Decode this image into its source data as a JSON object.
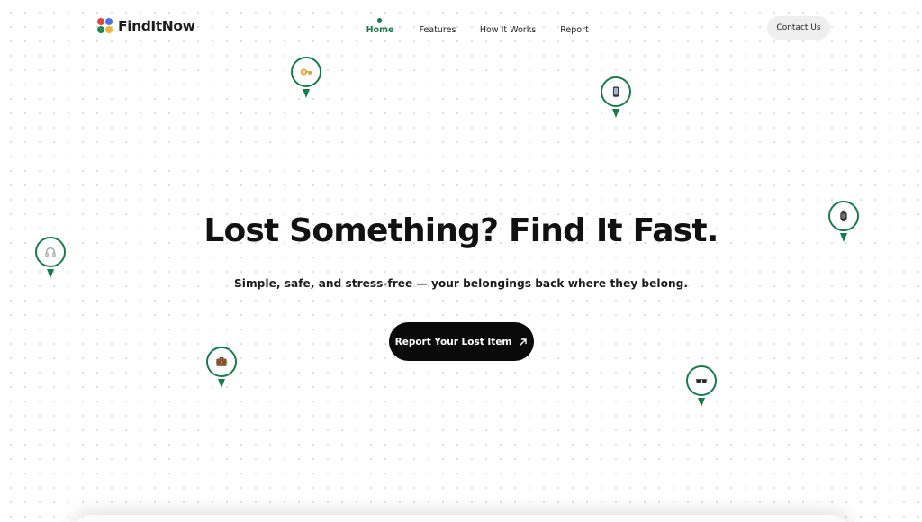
{
  "brand": {
    "name": "FindItNow",
    "logo_colors": [
      "#e2463f",
      "#4f73e0",
      "#1f8a5a",
      "#f0b43a"
    ]
  },
  "colors": {
    "accent": "#1a7a4c",
    "pin_green": "#1a7a4c",
    "cta_background": "#0a0a0a"
  },
  "nav": {
    "items": [
      {
        "label": "Home",
        "active": true
      },
      {
        "label": "Features",
        "active": false
      },
      {
        "label": "How It Works",
        "active": false
      },
      {
        "label": "Report",
        "active": false
      }
    ],
    "contact_label": "Contact Us"
  },
  "hero": {
    "title": "Lost Something? Find It Fast.",
    "subtitle": "Simple, safe, and stress-free — your belongings back where they belong.",
    "cta_label": "Report Your Lost Item",
    "cta_icon": "arrow-up-right-icon"
  },
  "pins": [
    {
      "icon": "key-icon"
    },
    {
      "icon": "phone-icon"
    },
    {
      "icon": "watch-icon"
    },
    {
      "icon": "headphones-icon"
    },
    {
      "icon": "briefcase-icon"
    },
    {
      "icon": "glasses-icon"
    }
  ]
}
